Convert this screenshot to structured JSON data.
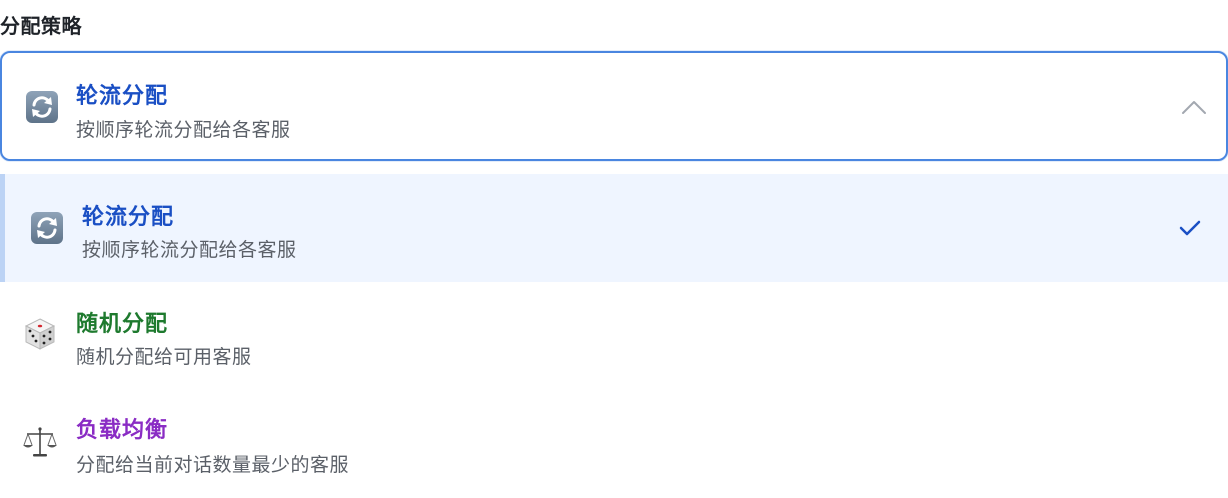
{
  "field": {
    "label": "分配策略"
  },
  "select": {
    "selected_title": "轮流分配",
    "selected_desc": "按顺序轮流分配给各客服",
    "selected_icon": "refresh-icon"
  },
  "options": [
    {
      "title": "轮流分配",
      "desc": "按顺序轮流分配给各客服",
      "icon": "refresh-icon",
      "color": "#1a4fc4",
      "selected": true
    },
    {
      "title": "随机分配",
      "desc": "随机分配给可用客服",
      "icon": "dice-icon",
      "color": "#1e7a2e",
      "selected": false
    },
    {
      "title": "负载均衡",
      "desc": "分配给当前对话数量最少的客服",
      "icon": "scales-icon",
      "color": "#8a2cc4",
      "selected": false
    }
  ],
  "colors": {
    "accent": "#4a86e0",
    "selected_bg": "#eff5ff",
    "checkmark": "#1a4fc4"
  }
}
